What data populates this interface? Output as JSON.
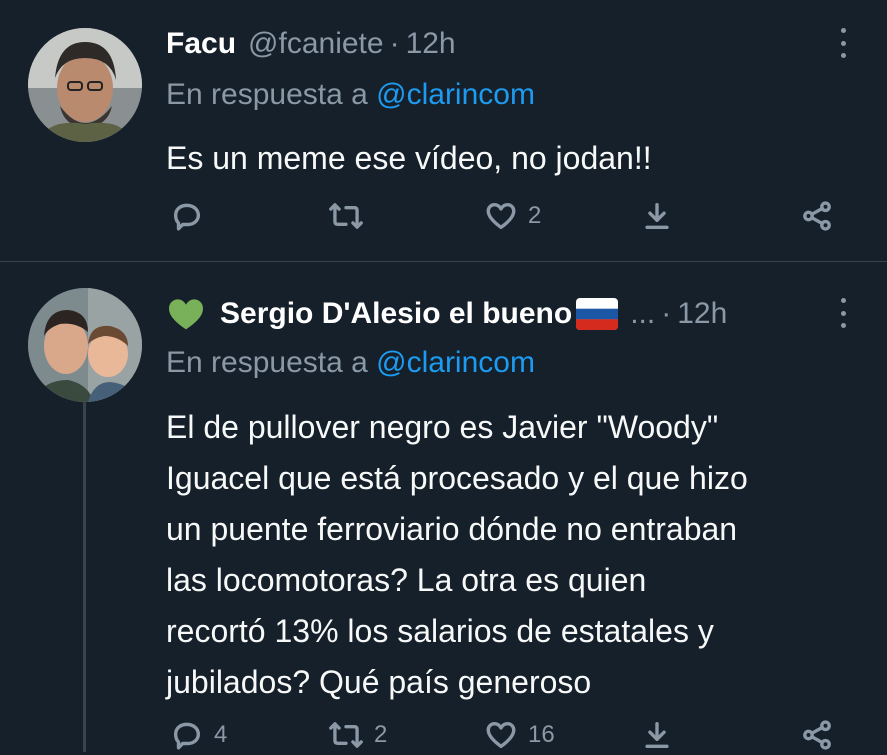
{
  "tweets": [
    {
      "name": "Facu",
      "handle": "@fcaniete",
      "time": "12h",
      "reply_prefix": "En respuesta a",
      "reply_mention": "@clarincom",
      "text_lines": [
        "Es un meme ese vídeo, no jodan!!"
      ],
      "counts": {
        "reply": "",
        "retweet": "",
        "like": "2"
      },
      "icons": [
        "reply-icon",
        "retweet-icon",
        "like-icon",
        "download-icon",
        "share-icon"
      ]
    },
    {
      "name": "Sergio D'Alesio el bueno",
      "name_suffix": "...",
      "time": "12h",
      "reply_prefix": "En respuesta a",
      "reply_mention": "@clarincom",
      "text_lines": [
        "El de pullover negro es Javier \"Woody\"",
        "Iguacel que está procesado y el que hizo",
        "un puente ferroviario dónde no entraban",
        "las locomotoras? La otra es quien",
        "recortó 13% los salarios de estatales y",
        "jubilados? Qué país generoso"
      ],
      "counts": {
        "reply": "4",
        "retweet": "2",
        "like": "16"
      },
      "icons": [
        "green-heart-icon",
        "russia-flag-icon",
        "reply-icon",
        "retweet-icon",
        "like-icon",
        "download-icon",
        "share-icon"
      ]
    }
  ],
  "separator": "·",
  "colors": {
    "background": "#15202b",
    "secondary_text": "#8b98a5",
    "link": "#1d9bf0",
    "divider": "#38444d"
  }
}
